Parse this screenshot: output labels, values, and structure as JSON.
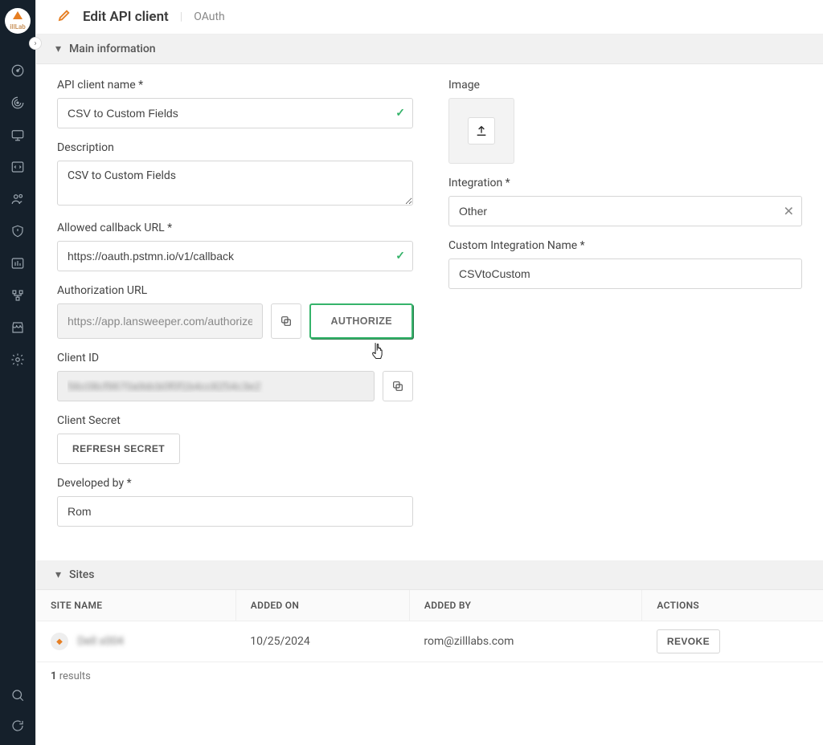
{
  "header": {
    "title": "Edit API client",
    "tab": "OAuth"
  },
  "sections": {
    "main": "Main information",
    "sites": "Sites"
  },
  "labels": {
    "api_client_name": "API client name *",
    "description": "Description",
    "callback": "Allowed callback URL *",
    "auth_url": "Authorization URL",
    "client_id": "Client ID",
    "client_secret": "Client Secret",
    "developed_by": "Developed by *",
    "image": "Image",
    "integration": "Integration *",
    "custom_integration": "Custom Integration Name *"
  },
  "values": {
    "api_client_name": "CSV to Custom Fields",
    "description": "CSV to Custom Fields",
    "callback": "https://oauth.pstmn.io/v1/callback",
    "auth_url": "https://app.lansweeper.com/authorize",
    "client_id": "56c08cf9670a9dcb0f0f1b4cc8254c3e2",
    "developed_by": "Rom",
    "integration": "Other",
    "custom_integration": "CSVtoCustom"
  },
  "buttons": {
    "authorize": "AUTHORIZE",
    "refresh": "REFRESH SECRET",
    "revoke": "REVOKE"
  },
  "sites": {
    "headers": {
      "name": "SITE NAME",
      "added_on": "ADDED ON",
      "added_by": "ADDED BY",
      "actions": "ACTIONS"
    },
    "rows": [
      {
        "name": "Dell x004",
        "added_on": "10/25/2024",
        "added_by": "rom@zilllabs.com"
      }
    ],
    "results_count": "1",
    "results_label": " results"
  },
  "icons": {
    "check": "✓",
    "clear": "✕",
    "chevron": "▾",
    "expand": "›"
  }
}
